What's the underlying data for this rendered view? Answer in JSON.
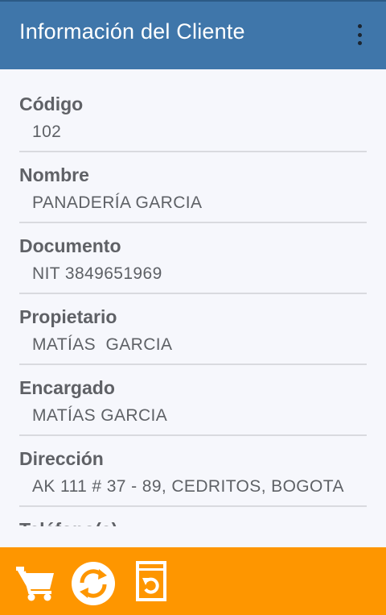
{
  "app_bar": {
    "title": "Información del Cliente",
    "menu_icon": "overflow-vertical-icon",
    "color": "#3f76aa"
  },
  "fields": [
    {
      "label": "Código",
      "value": "102"
    },
    {
      "label": "Nombre",
      "value": "PANADERÍA GARCIA"
    },
    {
      "label": "Documento",
      "value": "NIT 3849651969"
    },
    {
      "label": "Propietario",
      "value": "MATÍAS  GARCIA"
    },
    {
      "label": "Encargado",
      "value": "MATÍAS GARCIA"
    },
    {
      "label": "Dirección",
      "value": "AK 111 # 37 - 89, CEDRITOS, BOGOTA"
    },
    {
      "label": "Teléfono(s)",
      "value": ""
    }
  ],
  "bottom_bar": {
    "color": "#fe9600",
    "icons": [
      "shopping-cart-icon",
      "sync-icon",
      "return-document-icon"
    ]
  }
}
